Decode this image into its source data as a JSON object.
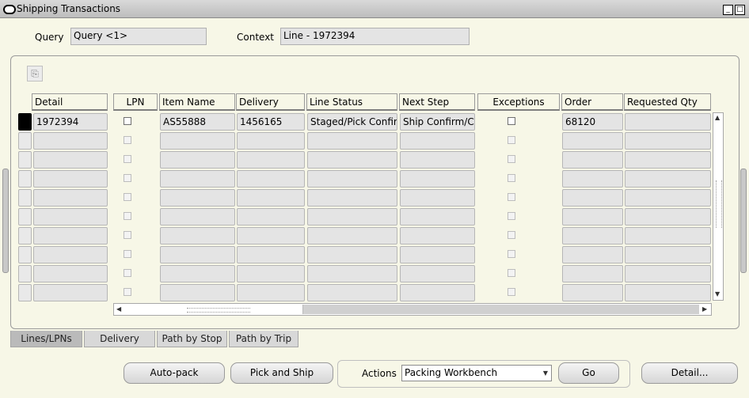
{
  "window": {
    "title": "Shipping Transactions",
    "minimize": "_",
    "maximize": "□"
  },
  "query": {
    "label": "Query",
    "value": "Query <1>"
  },
  "context": {
    "label": "Context",
    "value": "Line - 1972394"
  },
  "table": {
    "headers": [
      "Detail",
      "LPN",
      "Item Name",
      "Delivery",
      "Line Status",
      "Next Step",
      "Exceptions",
      "Order",
      "Requested Qty"
    ],
    "rows": [
      {
        "detail": "1972394",
        "item": "AS55888",
        "delivery": "1456165",
        "status": "Staged/Pick Confirmed",
        "next": "Ship Confirm/Close Trip",
        "order": "68120",
        "qty": ""
      }
    ],
    "empty_rows": 9
  },
  "tabs": [
    "Lines/LPNs",
    "Delivery",
    "Path by Stop",
    "Path by Trip"
  ],
  "buttons": {
    "autopack": "Auto-pack",
    "pickship": "Pick and Ship",
    "actions_label": "Actions",
    "actions_value": "Packing Workbench",
    "go": "Go",
    "detail": "Detail..."
  },
  "icons": {
    "folder": "folder-icon",
    "scroll_up": "▲",
    "scroll_down": "▼",
    "scroll_left": "◀",
    "scroll_right": "▶",
    "dropdown": "▼"
  }
}
